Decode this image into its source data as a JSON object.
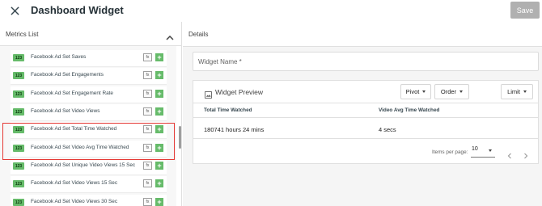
{
  "header": {
    "title": "Dashboard Widget",
    "save_label": "Save"
  },
  "metrics": {
    "title": "Metrics List",
    "items": [
      {
        "badge": "123",
        "label": "Facebook Ad Set Saves"
      },
      {
        "badge": "123",
        "label": "Facebook Ad Set Engagements"
      },
      {
        "badge": "123",
        "label": "Facebook Ad Set Engagement Rate"
      },
      {
        "badge": "123",
        "label": "Facebook Ad Set Video Views"
      },
      {
        "badge": "123",
        "label": "Facebook Ad Set Total Time Watched"
      },
      {
        "badge": "123",
        "label": "Facebook Ad Set Video Avg Time Watched"
      },
      {
        "badge": "123",
        "label": "Facebook Ad Set Unique Video Views 15 Sec"
      },
      {
        "badge": "123",
        "label": "Facebook Ad Set Video Views 15 Sec"
      },
      {
        "badge": "123",
        "label": "Facebook Ad Set Video Views 30 Sec"
      }
    ],
    "fx_label": "fx",
    "plus_label": "+"
  },
  "details": {
    "title": "Details",
    "widget_name_placeholder": "Widget Name *",
    "preview": {
      "title": "Widget Preview",
      "buttons": {
        "pivot": "Pivot",
        "order": "Order",
        "limit": "Limit"
      },
      "columns": [
        "Total Time Watched",
        "Video Avg Time Watched"
      ],
      "row": [
        "180741 hours 24 mins",
        "4 secs"
      ],
      "items_per_page_label": "Items per page:",
      "items_per_page_value": "10"
    }
  },
  "colors": {
    "accent_green": "#66bb6a",
    "highlight_red": "#e53935",
    "save_disabled": "#b0b0b0"
  }
}
